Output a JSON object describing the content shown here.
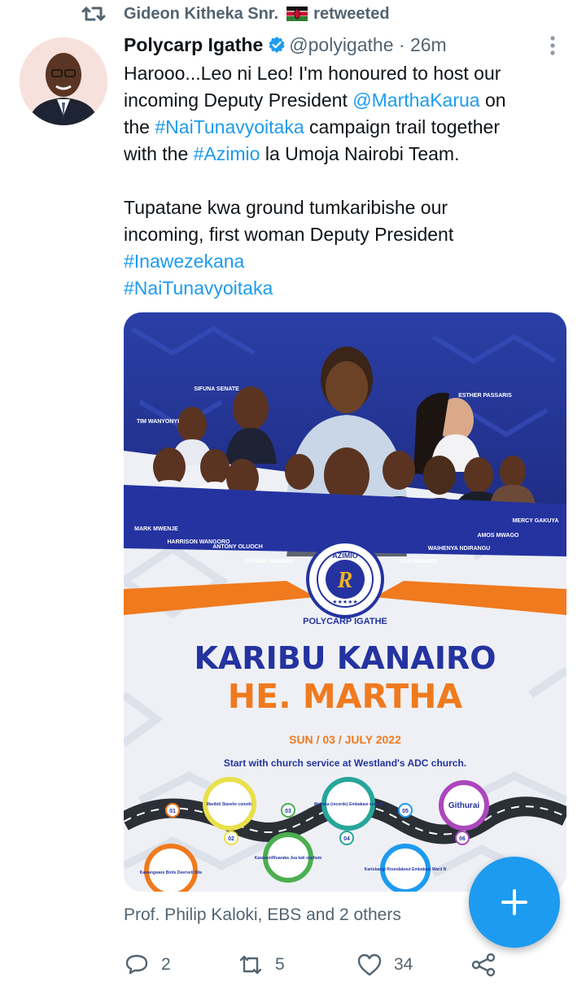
{
  "retweet": {
    "text": "Gideon Kitheka Snr.",
    "suffix": "retweeted"
  },
  "tweet": {
    "author": "Polycarp Igathe",
    "handle": "@polyigathe",
    "separator": "·",
    "time": "26m",
    "line1": "Harooo...Leo ni Leo! I'm honoured to host our",
    "line2_pre": "incoming Deputy President ",
    "line2_mention": "@MarthaKarua",
    "line2_post": " on",
    "line3_pre": "the ",
    "line3_hashtag": "#NaiTunavyoitaka",
    "line3_post": " campaign trail together",
    "line4_pre": "with the ",
    "line4_hashtag": "#Azimio",
    "line4_post": " la Umoja Nairobi Team.",
    "line5": "Tupatane kwa ground tumkaribishe our",
    "line6": "incoming, first woman Deputy President",
    "hashtag1": "#Inawezekana",
    "hashtag2": "#NaiTunavyoitaka"
  },
  "poster": {
    "people": {
      "tim": "TIM WANYONYI",
      "sifuna": "SIFUNA SENATE",
      "esther": "ESTHER PASSARIS",
      "mark": "MARK MWENJE",
      "harrison": "HARRISON WANGORO",
      "antony": "ANTONY OLUOCH",
      "dennis": "DENNIS WAWERU",
      "sam": "SAM MWANGI",
      "waihenya": "WAIHENYA NDIRANGU",
      "amos": "AMOS MWAGO",
      "mercy": "MERCY GAKUYA"
    },
    "logo_text": "AZIMIO",
    "logo_letter": "R",
    "host": "POLYCARP IGATHE",
    "headline1": "KARIBU KANAIRO",
    "headline2": "HE. MARTHA",
    "date": "SUN / 03 / JULY 2022",
    "subtitle": "Start with church service at Westland's ADC church.",
    "stops": [
      {
        "num": "01",
        "label": "Kawangware Birds Deerveti Site"
      },
      {
        "num": "02",
        "label": "Marikiti Starehe constit."
      },
      {
        "num": "03",
        "label": "Kasarani/Ruaraka Jua kali stadium"
      },
      {
        "num": "04",
        "label": "Wairaka (recorde) Embakasi central"
      },
      {
        "num": "05",
        "label": "Kariobangi Roundabout Embakasi Ward N"
      },
      {
        "num": "06",
        "label": "Githurai"
      }
    ]
  },
  "likers": "Prof. Philip Kaloki, EBS and 2 others",
  "actions": {
    "replies": "2",
    "retweets": "5",
    "likes": "34"
  },
  "colors": {
    "accent": "#1d9bf0",
    "poster_blue": "#2b3aa8",
    "poster_orange": "#f07a1e"
  },
  "icons": [
    "retweet-icon",
    "kenya-flag-icon",
    "verified-icon",
    "more-icon",
    "reply-icon",
    "like-icon",
    "share-icon",
    "plus-icon"
  ]
}
